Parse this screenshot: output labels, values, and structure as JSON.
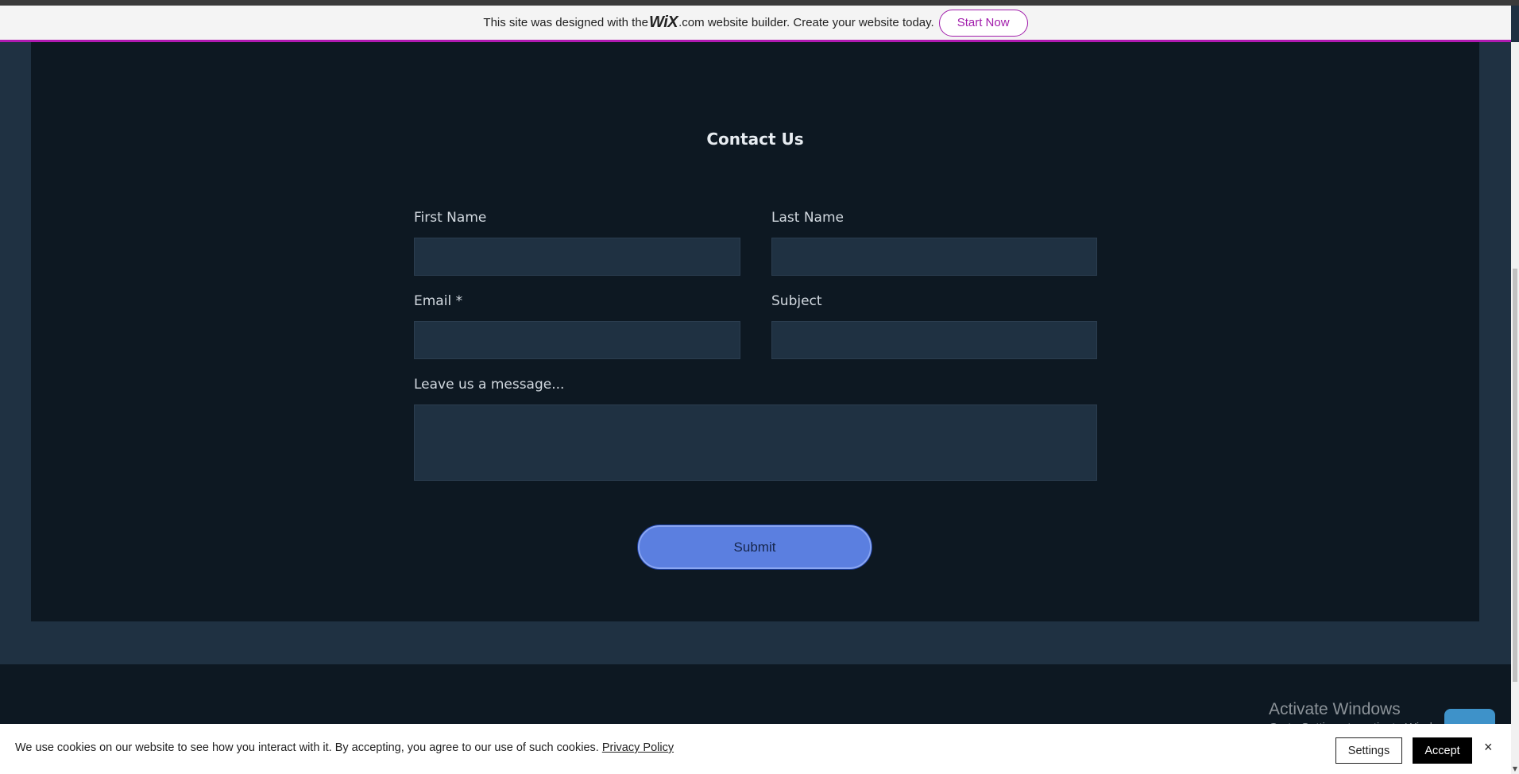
{
  "wix_banner": {
    "text_before": "This site was designed with the ",
    "logo": "WiX",
    "text_after": ".com website builder. Create your website today.",
    "button_label": "Start Now"
  },
  "contact": {
    "title": "Contact Us",
    "fields": {
      "first_name": {
        "label": "First Name",
        "value": ""
      },
      "last_name": {
        "label": "Last Name",
        "value": ""
      },
      "email": {
        "label": "Email *",
        "value": ""
      },
      "subject": {
        "label": "Subject",
        "value": ""
      },
      "message": {
        "label": "Leave us a message...",
        "value": ""
      }
    },
    "submit_label": "Submit"
  },
  "watermark": {
    "title": "Activate Windows",
    "subtitle": "Go to Settings to activate Windows."
  },
  "cookie_bar": {
    "text": "We use cookies on our website to see how you interact with it. By accepting, you agree to our use of such cookies. ",
    "privacy_link": "Privacy Policy",
    "settings_label": "Settings",
    "accept_label": "Accept",
    "close_icon": "×"
  },
  "colors": {
    "panel": "#0d1822",
    "background": "#1f3142",
    "input": "#1f3142",
    "submit": "#5b7fe0",
    "wix_accent": "#a11cab"
  }
}
